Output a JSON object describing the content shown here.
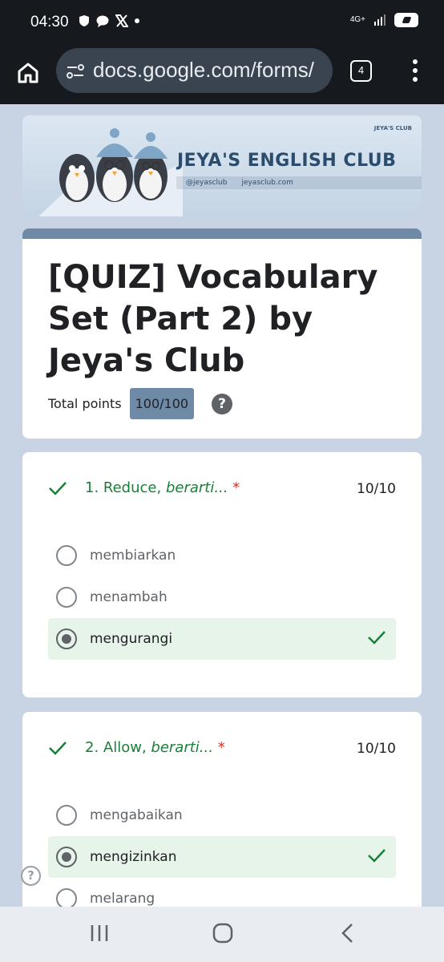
{
  "status": {
    "time": "04:30",
    "network": "4G+"
  },
  "browser": {
    "url": "docs.google.com/forms/",
    "tab_count": "4"
  },
  "banner": {
    "title": "JEYA'S ENGLISH CLUB",
    "instagram": "@jeyasclub",
    "website": "jeyasclub.com",
    "logo_text": "JEYA'S CLUB"
  },
  "form": {
    "title": "[QUIZ] Vocabulary Set (Part 2) by Jeya's Club",
    "points_label": "Total points",
    "points_value": "100/100",
    "help_glyph": "?"
  },
  "questions": [
    {
      "number_word": "1. Reduce,",
      "italic": "berarti...",
      "required": "*",
      "score": "10/10",
      "options": [
        {
          "label": "membiarkan",
          "selected": false
        },
        {
          "label": "menambah",
          "selected": false
        },
        {
          "label": "mengurangi",
          "selected": true,
          "correct": true
        }
      ]
    },
    {
      "number_word": "2. Allow,",
      "italic": "berarti...",
      "required": "*",
      "score": "10/10",
      "options": [
        {
          "label": "mengabaikan",
          "selected": false
        },
        {
          "label": "mengizinkan",
          "selected": true,
          "correct": true
        },
        {
          "label": "melarang",
          "selected": false
        }
      ]
    }
  ],
  "colors": {
    "correct": "#188038",
    "accent": "#6e8aa7",
    "selected_bg": "#e6f4ea"
  },
  "icons": [
    "home-icon",
    "site-settings-icon",
    "tabs-icon",
    "menu-icon",
    "check-icon",
    "radio-icon",
    "help-icon"
  ]
}
